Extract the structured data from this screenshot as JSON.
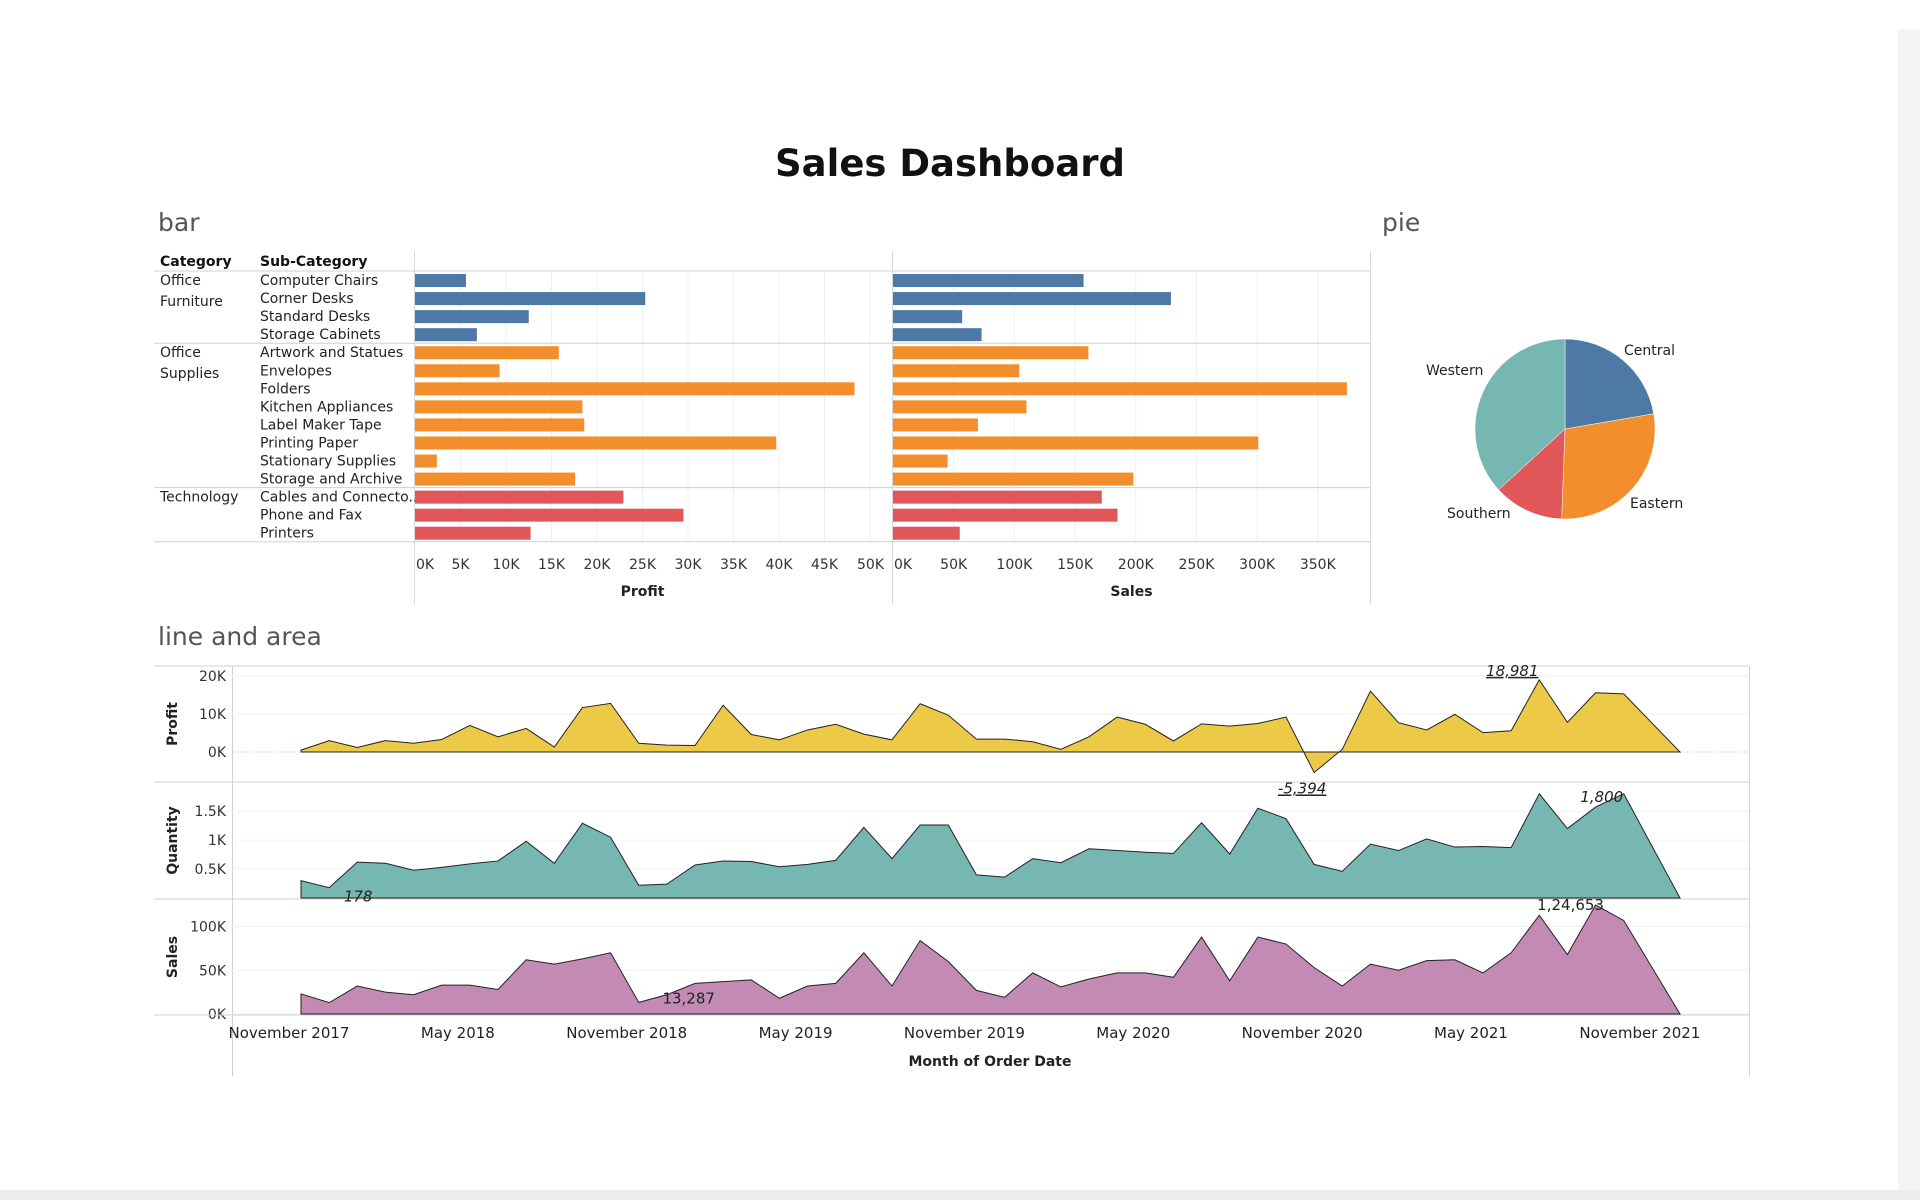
{
  "dashboard_title": "Sales Dashboard",
  "sheets": {
    "bar": "bar",
    "pie": "pie",
    "line": "line and area"
  },
  "colors": {
    "Office Furniture": "#4e79a7",
    "Office Supplies": "#f28e2b",
    "Technology": "#e15759",
    "Western": "#76b7b2",
    "Profit": "#edc948",
    "Quantity": "#76b7b2",
    "Sales": "#c38bb3"
  },
  "chart_data": [
    {
      "type": "bar",
      "orientation": "horizontal",
      "headers": {
        "category": "Category",
        "sub_category": "Sub-Category"
      },
      "groups": [
        {
          "category": "Office\nFurniture",
          "color_key": "Office Furniture",
          "items": [
            {
              "name": "Computer Chairs",
              "profit": 5600,
              "sales": 157000
            },
            {
              "name": "Corner Desks",
              "profit": 25300,
              "sales": 229000
            },
            {
              "name": "Standard Desks",
              "profit": 12500,
              "sales": 57000
            },
            {
              "name": "Storage Cabinets",
              "profit": 6800,
              "sales": 73000
            }
          ]
        },
        {
          "category": "Office\nSupplies",
          "color_key": "Office Supplies",
          "items": [
            {
              "name": "Artwork and Statues",
              "profit": 15800,
              "sales": 161000
            },
            {
              "name": "Envelopes",
              "profit": 9300,
              "sales": 104000
            },
            {
              "name": "Folders",
              "profit": 48300,
              "sales": 374000
            },
            {
              "name": "Kitchen Appliances",
              "profit": 18400,
              "sales": 110000
            },
            {
              "name": "Label Maker Tape",
              "profit": 18600,
              "sales": 70000
            },
            {
              "name": "Printing Paper",
              "profit": 39700,
              "sales": 301000
            },
            {
              "name": "Stationary Supplies",
              "profit": 2400,
              "sales": 45000
            },
            {
              "name": "Storage and Archive",
              "profit": 17600,
              "sales": 198000
            }
          ]
        },
        {
          "category": "Technology",
          "color_key": "Technology",
          "items": [
            {
              "name": "Cables and Connecto..",
              "profit": 22900,
              "sales": 172000
            },
            {
              "name": "Phone and Fax",
              "profit": 29500,
              "sales": 185000
            },
            {
              "name": "Printers",
              "profit": 12700,
              "sales": 55000
            }
          ]
        }
      ],
      "panels": [
        {
          "measure": "profit",
          "xlabel": "Profit",
          "xlim": [
            0,
            50000
          ],
          "ticks": [
            0,
            5000,
            10000,
            15000,
            20000,
            25000,
            30000,
            35000,
            40000,
            45000,
            50000
          ],
          "tick_labels": [
            "0K",
            "5K",
            "10K",
            "15K",
            "20K",
            "25K",
            "30K",
            "35K",
            "40K",
            "45K",
            "50K"
          ]
        },
        {
          "measure": "sales",
          "xlabel": "Sales",
          "xlim": [
            0,
            393000
          ],
          "ticks": [
            0,
            50000,
            100000,
            150000,
            200000,
            250000,
            300000,
            350000
          ],
          "tick_labels": [
            "0K",
            "50K",
            "100K",
            "150K",
            "200K",
            "250K",
            "300K",
            "350K"
          ]
        }
      ],
      "grid": true
    },
    {
      "type": "pie",
      "slices": [
        {
          "label": "Central",
          "value": 22.3,
          "color": "#4e79a7"
        },
        {
          "label": "Eastern",
          "value": 28.3,
          "color": "#f28e2b"
        },
        {
          "label": "Southern",
          "value": 12.6,
          "color": "#e15759"
        },
        {
          "label": "Western",
          "value": 36.8,
          "color": "#76b7b2"
        }
      ]
    },
    {
      "type": "area",
      "xlabel": "Month of Order Date",
      "x_tick_labels": [
        {
          "label": "November 2017",
          "index": 0
        },
        {
          "label": "May 2018",
          "index": 6
        },
        {
          "label": "November 2018",
          "index": 12
        },
        {
          "label": "May 2019",
          "index": 18
        },
        {
          "label": "November 2019",
          "index": 24
        },
        {
          "label": "May 2020",
          "index": 30
        },
        {
          "label": "November 2020",
          "index": 36
        },
        {
          "label": "May 2021",
          "index": 42
        },
        {
          "label": "November 2021",
          "index": 48
        }
      ],
      "months": [
        "2017-11",
        "2017-12",
        "2018-01",
        "2018-02",
        "2018-03",
        "2018-04",
        "2018-05",
        "2018-06",
        "2018-07",
        "2018-08",
        "2018-09",
        "2018-10",
        "2018-11",
        "2018-12",
        "2019-01",
        "2019-02",
        "2019-03",
        "2019-04",
        "2019-05",
        "2019-06",
        "2019-07",
        "2019-08",
        "2019-09",
        "2019-10",
        "2019-11",
        "2019-12",
        "2020-01",
        "2020-02",
        "2020-03",
        "2020-04",
        "2020-05",
        "2020-06",
        "2020-07",
        "2020-08",
        "2020-09",
        "2020-10",
        "2020-11",
        "2020-12",
        "2021-01",
        "2021-02",
        "2021-03",
        "2021-04",
        "2021-05",
        "2021-06",
        "2021-07",
        "2021-08",
        "2021-09",
        "2021-10",
        "2021-11",
        "2021-12"
      ],
      "series": [
        {
          "name": "Profit",
          "ylabel": "Profit",
          "ylim": [
            -7000,
            21000
          ],
          "ticks": [
            0,
            10000,
            20000
          ],
          "tick_labels": [
            "0K",
            "10K",
            "20K"
          ],
          "values": [
            500,
            3000,
            1200,
            3000,
            2300,
            3300,
            7000,
            4000,
            6200,
            1300,
            11700,
            12800,
            2300,
            1800,
            1700,
            12300,
            4600,
            3200,
            5800,
            7300,
            4700,
            3200,
            12700,
            9700,
            3400,
            3400,
            2700,
            700,
            4000,
            9200,
            7300,
            2900,
            7400,
            6800,
            7500,
            9200,
            -5394,
            700,
            16000,
            7700,
            5800,
            9900,
            5100,
            5600,
            18981,
            7800,
            15600,
            15300
          ],
          "annotations": [
            {
              "index": 44,
              "text": "18,981"
            },
            {
              "index": 36,
              "text": "-5,394"
            }
          ]
        },
        {
          "name": "Quantity",
          "ylabel": "Quantity",
          "ylim": [
            0,
            1900
          ],
          "ticks": [
            500,
            1000,
            1500
          ],
          "tick_labels": [
            "0.5K",
            "1K",
            "1.5K"
          ],
          "values": [
            300,
            178,
            620,
            600,
            480,
            530,
            590,
            640,
            980,
            600,
            1290,
            1050,
            220,
            240,
            570,
            640,
            630,
            540,
            580,
            650,
            1220,
            680,
            1260,
            1260,
            400,
            360,
            680,
            610,
            850,
            820,
            790,
            770,
            1300,
            760,
            1550,
            1370,
            580,
            460,
            930,
            820,
            1020,
            880,
            890,
            870,
            1800,
            1200,
            1570,
            1800
          ],
          "annotations": [
            {
              "index": 1,
              "text": "178"
            },
            {
              "index": 47,
              "text": "1,800"
            }
          ]
        },
        {
          "name": "Sales",
          "ylabel": "Sales",
          "ylim": [
            0,
            124653
          ],
          "ticks": [
            0,
            50000,
            100000
          ],
          "tick_labels": [
            "0K",
            "50K",
            "100K"
          ],
          "values": [
            23000,
            13000,
            32000,
            25000,
            22000,
            33000,
            33000,
            28000,
            62000,
            57000,
            63000,
            70000,
            13287,
            22000,
            35000,
            37000,
            39000,
            18000,
            32000,
            35000,
            70000,
            32000,
            84000,
            60000,
            27000,
            19000,
            47000,
            31000,
            40000,
            47000,
            47000,
            42000,
            88000,
            38000,
            88000,
            80000,
            53000,
            32000,
            57000,
            50000,
            61000,
            62000,
            47000,
            70000,
            113000,
            68000,
            124653,
            107000
          ],
          "annotations": [
            {
              "index": 12,
              "text": "13,287"
            },
            {
              "index": 46,
              "text": "1,24,653"
            }
          ]
        }
      ]
    }
  ]
}
